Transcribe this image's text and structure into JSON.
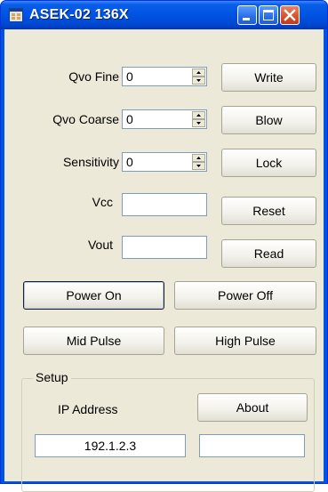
{
  "window": {
    "title": "ASEK-02 136X",
    "colors": {
      "titlebar": "#0054e3",
      "face": "#ece9d8",
      "close": "#d7542e"
    },
    "controls": [
      "minimize-icon",
      "maximize-icon",
      "close-icon"
    ]
  },
  "fields": {
    "qvo_fine": {
      "label": "Qvo Fine",
      "value": "0"
    },
    "qvo_coarse": {
      "label": "Qvo Coarse",
      "value": "0"
    },
    "sensitivity": {
      "label": "Sensitivity",
      "value": "0"
    },
    "vcc": {
      "label": "Vcc",
      "value": ""
    },
    "vout": {
      "label": "Vout",
      "value": ""
    }
  },
  "buttons": {
    "write": "Write",
    "blow": "Blow",
    "lock": "Lock",
    "reset": "Reset",
    "read": "Read",
    "power_on": "Power On",
    "power_off": "Power Off",
    "mid_pulse": "Mid Pulse",
    "high_pulse": "High Pulse",
    "about": "About"
  },
  "setup": {
    "title": "Setup",
    "ip_label": "IP Address",
    "ip_value": "192.1.2.3",
    "aux_value": ""
  }
}
